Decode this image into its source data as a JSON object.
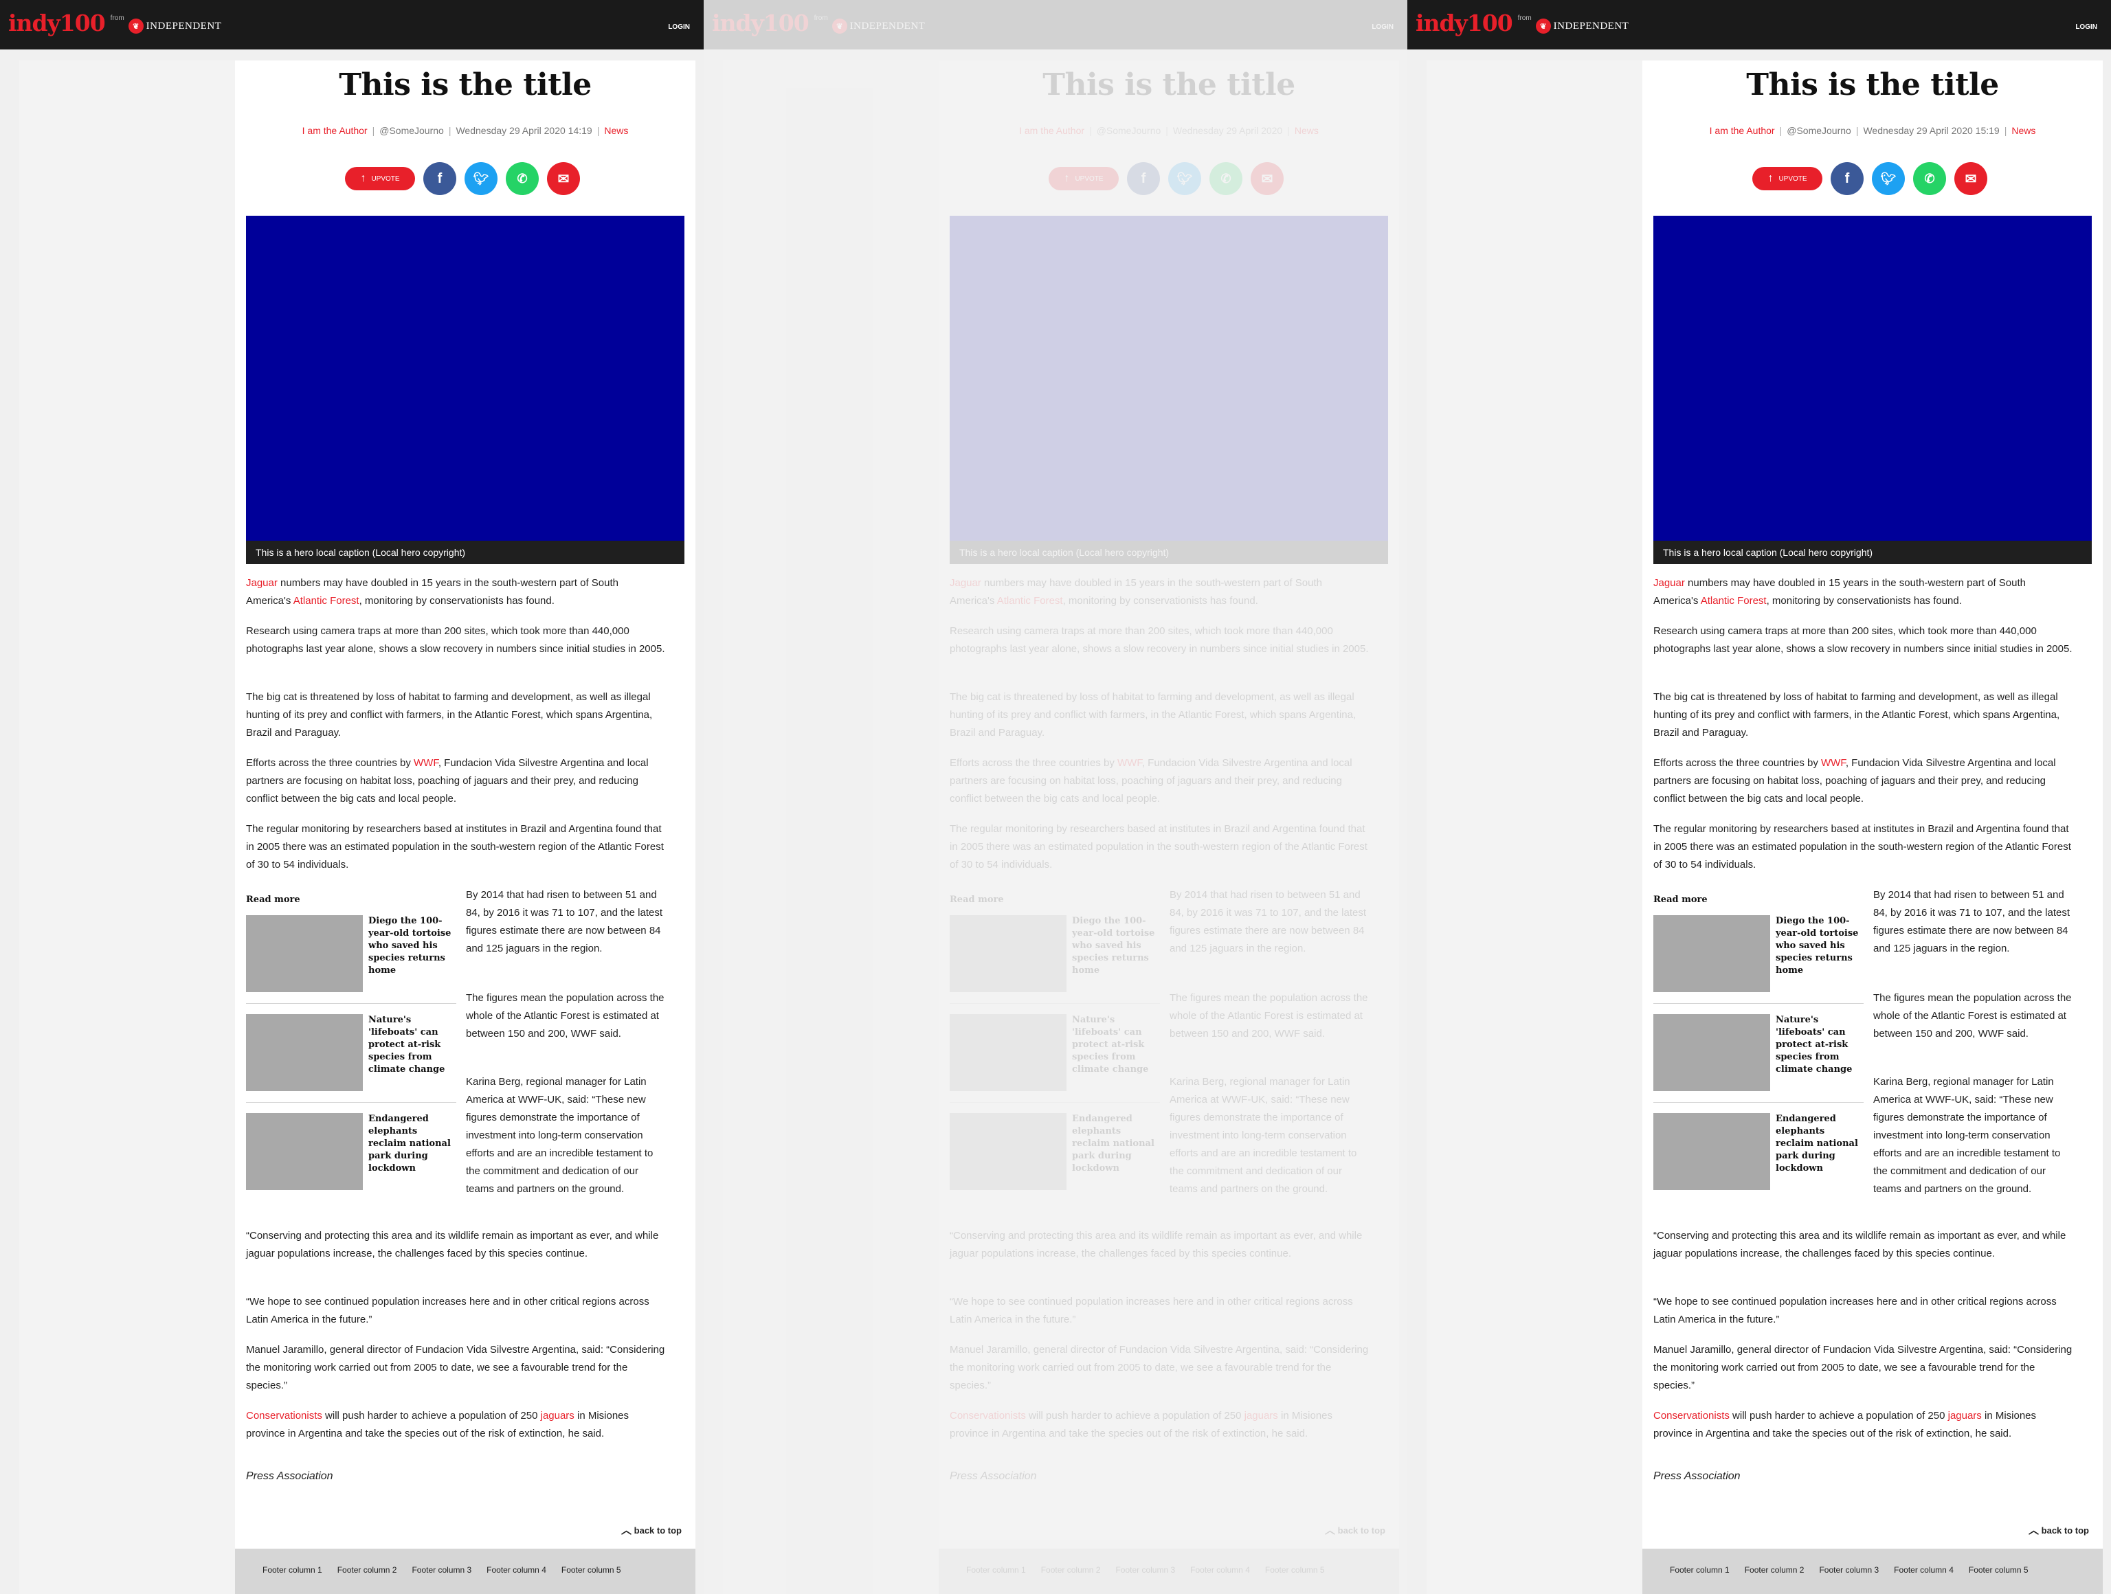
{
  "header": {
    "logo": "indy100",
    "from": "from",
    "brand": "INDEPENDENT",
    "login": "LOGIN"
  },
  "panels": [
    {
      "byline_time": "Wednesday 29 April 2020 14:19"
    },
    {
      "byline_time": "Wednesday 29 April 2020"
    },
    {
      "byline_time": "Wednesday 29 April 2020 15:19"
    }
  ],
  "article": {
    "title": "This is the title",
    "author": "I am the Author",
    "handle": "@SomeJourno",
    "section": "News",
    "upvote": "UPVOTE",
    "caption": "This is a hero local caption (Local hero copyright)",
    "p1_link1": "Jaguar",
    "p1_text1": " numbers may have doubled in 15 years in the south-western part of South America's ",
    "p1_link2": "Atlantic Forest",
    "p1_text2": ", monitoring by conservationists has found.",
    "p2": "Research using camera traps at more than 200 sites, which took more than 440,000 photographs last year alone, shows a slow recovery in numbers since initial studies in 2005.",
    "p3": "The big cat is threatened by loss of habitat to farming and development, as well as illegal hunting of its prey and conflict with farmers, in the Atlantic Forest, which spans Argentina, Brazil and Paraguay.",
    "p4_text1": "Efforts across the three countries by ",
    "p4_link": "WWF",
    "p4_text2": ", Fundacion Vida Silvestre Argentina and local partners are focusing on habitat loss, poaching of jaguars and their prey, and reducing conflict between the big cats and local people.",
    "p5": "The regular monitoring by researchers based at institutes in Brazil and Argentina found that in 2005 there was an estimated population in the south-western region of the Atlantic Forest of 30 to 54 individuals.",
    "p6": "By 2014 that had risen to between 51 and 84, by 2016 it was 71 to 107, and the latest figures estimate there are now between 84 and 125 jaguars in the region.",
    "p7": "The figures mean the population across the whole of the Atlantic Forest is estimated at between 150 and 200, WWF said.",
    "p8": "Karina Berg, regional manager for Latin America at WWF-UK, said: “These new figures demonstrate the importance of investment into long-term conservation efforts and are an incredible testament to the commitment and dedication of our teams and partners on the ground.",
    "p9": "“Conserving and protecting this area and its wildlife remain as important as ever, and while jaguar populations increase, the challenges faced by this species continue.",
    "p10": "“We hope to see continued population increases here and in other critical regions across Latin America in the future.”",
    "p11": "Manuel Jaramillo, general director of Fundacion Vida Silvestre Argentina, said: “Considering the monitoring work carried out from 2005 to date, we see a favourable trend for the species.”",
    "p12_link1": "Conservationists",
    "p12_text1": " will push harder to achieve a population of 250 ",
    "p12_link2": "jaguars",
    "p12_text2": " in Misiones province in Argentina and take the species out of the risk of extinction, he said.",
    "credit": "Press Association"
  },
  "readmore": {
    "label": "Read more",
    "items": [
      "Diego the 100-year-old tortoise who saved his species returns home",
      "Nature's 'lifeboats' can protect at-risk species from climate change",
      "Endangered elephants reclaim national park during lockdown"
    ]
  },
  "back_to_top": "back to top",
  "footer": {
    "columns": [
      "Footer column 1",
      "Footer column 2",
      "Footer column 3",
      "Footer column 4",
      "Footer column 5"
    ]
  },
  "colors": {
    "accent": "#e8202a",
    "topbar": "#1a1a1a",
    "hero": "#000099",
    "facebook": "#3b5998",
    "twitter": "#1da1f2",
    "whatsapp": "#25d366"
  }
}
